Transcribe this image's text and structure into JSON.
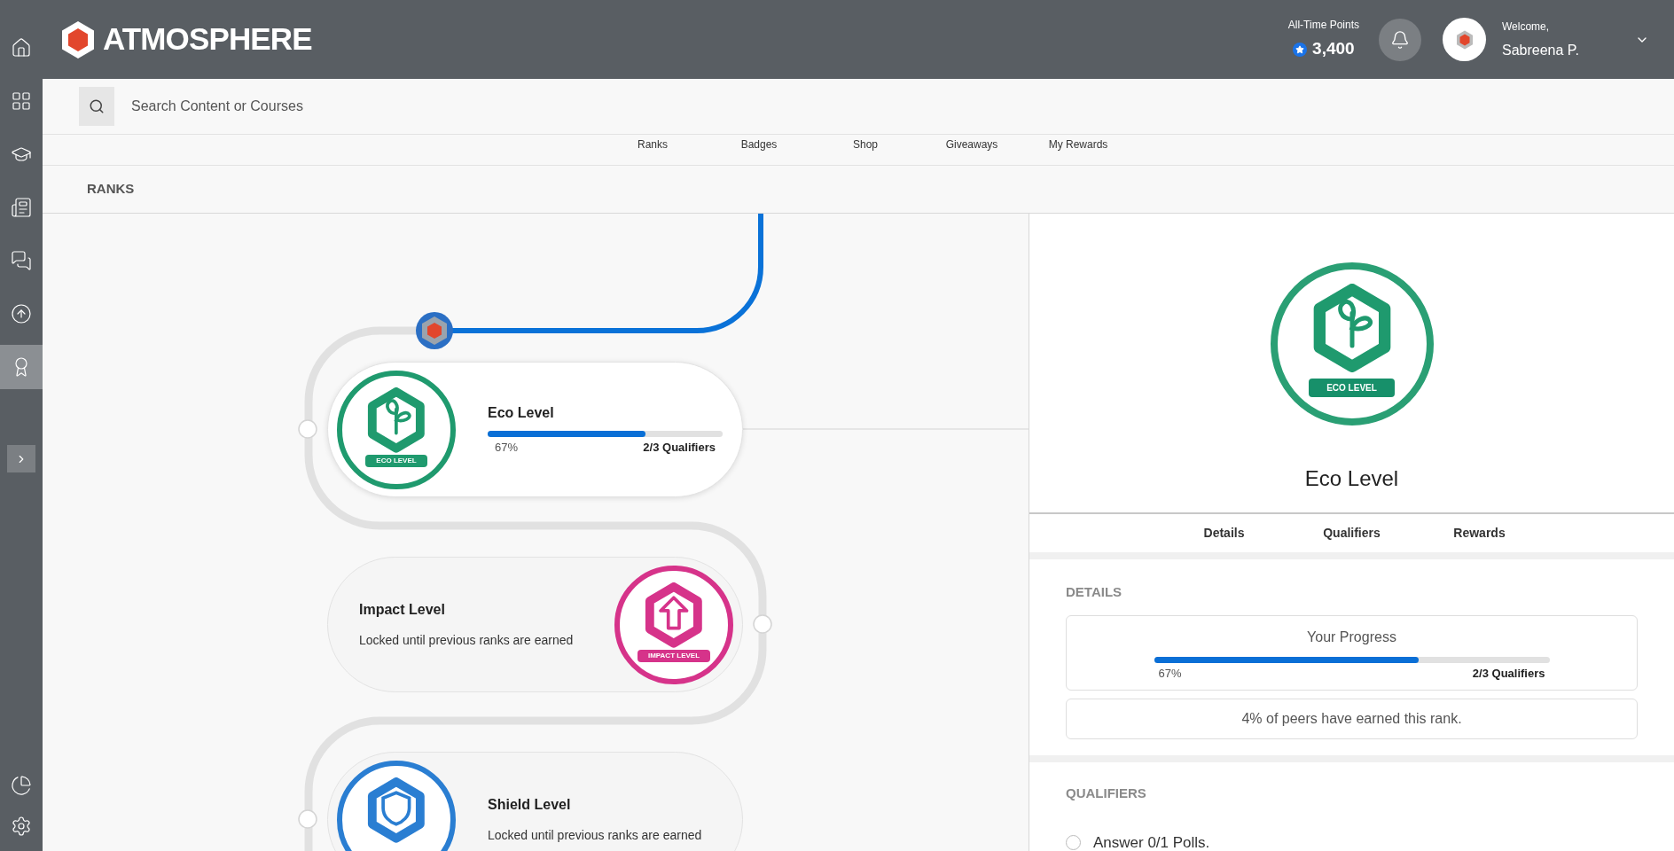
{
  "header": {
    "brand": "ATMOSPHERE",
    "points_label": "All-Time Points",
    "points": "3,400",
    "welcome": "Welcome,",
    "user": "Sabreena P."
  },
  "sidebar": {
    "items": [
      {
        "selected": false
      },
      {
        "selected": false
      },
      {
        "selected": false
      },
      {
        "selected": false
      },
      {
        "selected": false
      },
      {
        "selected": false
      },
      {
        "selected": true
      }
    ]
  },
  "search": {
    "placeholder": "Search Content or Courses"
  },
  "nav": [
    "Ranks",
    "Badges",
    "Shop",
    "Giveaways",
    "My Rewards"
  ],
  "page_title": "RANKS",
  "ranks": [
    {
      "name": "Eco Level",
      "kind": "progress",
      "selected": true,
      "level": 0.67,
      "percent": "67%",
      "qualifiers": "2/3 Qualifiers",
      "badge_label": "ECO LEVEL",
      "color": "#1f9a6e"
    },
    {
      "name": "Impact Level",
      "kind": "locked",
      "selected": false,
      "status": "Locked until previous ranks are earned",
      "badge_label": "IMPACT LEVEL",
      "color": "#d6338a"
    },
    {
      "name": "Shield Level",
      "kind": "locked",
      "selected": false,
      "status": "Locked until previous ranks are earned",
      "color": "#2a7ed2"
    }
  ],
  "detail": {
    "badge_label": "ECO LEVEL",
    "title": "Eco Level",
    "tabs": [
      "Details",
      "Qualifiers",
      "Rewards"
    ],
    "details_heading": "DETAILS",
    "progress_title": "Your Progress",
    "level": 0.67,
    "percent": "67%",
    "qualifiers": "2/3 Qualifiers",
    "peers": "4% of peers have earned this rank.",
    "qualifiers_heading": "QUALIFIERS",
    "qualifier_items": [
      {
        "text": "Answer 0/1 Polls.",
        "checked": false
      }
    ]
  }
}
